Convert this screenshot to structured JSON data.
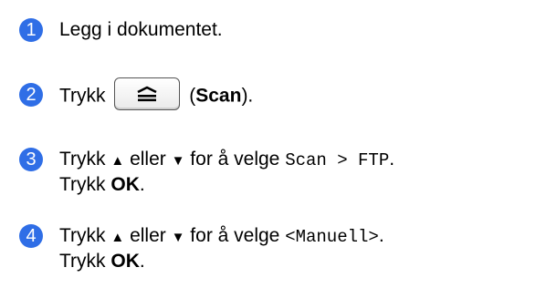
{
  "colors": {
    "badge": "#2f6ee6",
    "badge_text": "#ffffff",
    "text": "#000000"
  },
  "steps": [
    {
      "number": "1",
      "text": "Legg i dokumentet."
    },
    {
      "number": "2",
      "pre": "Trykk",
      "key_icon": "scan-key-icon",
      "paren_open": "(",
      "bold": "Scan",
      "paren_close": ")."
    },
    {
      "number": "3",
      "line1": {
        "pre": "Trykk ",
        "up": "▲",
        "mid1": " eller ",
        "down": "▼",
        "mid2": " for å velge ",
        "mono": "Scan > FTP",
        "post": "."
      },
      "line2": {
        "pre": "Trykk ",
        "bold": "OK",
        "post": "."
      }
    },
    {
      "number": "4",
      "line1": {
        "pre": "Trykk ",
        "up": "▲",
        "mid1": " eller ",
        "down": "▼",
        "mid2": " for å velge ",
        "mono": "<Manuell>",
        "post": "."
      },
      "line2": {
        "pre": "Trykk ",
        "bold": "OK",
        "post": "."
      }
    }
  ]
}
